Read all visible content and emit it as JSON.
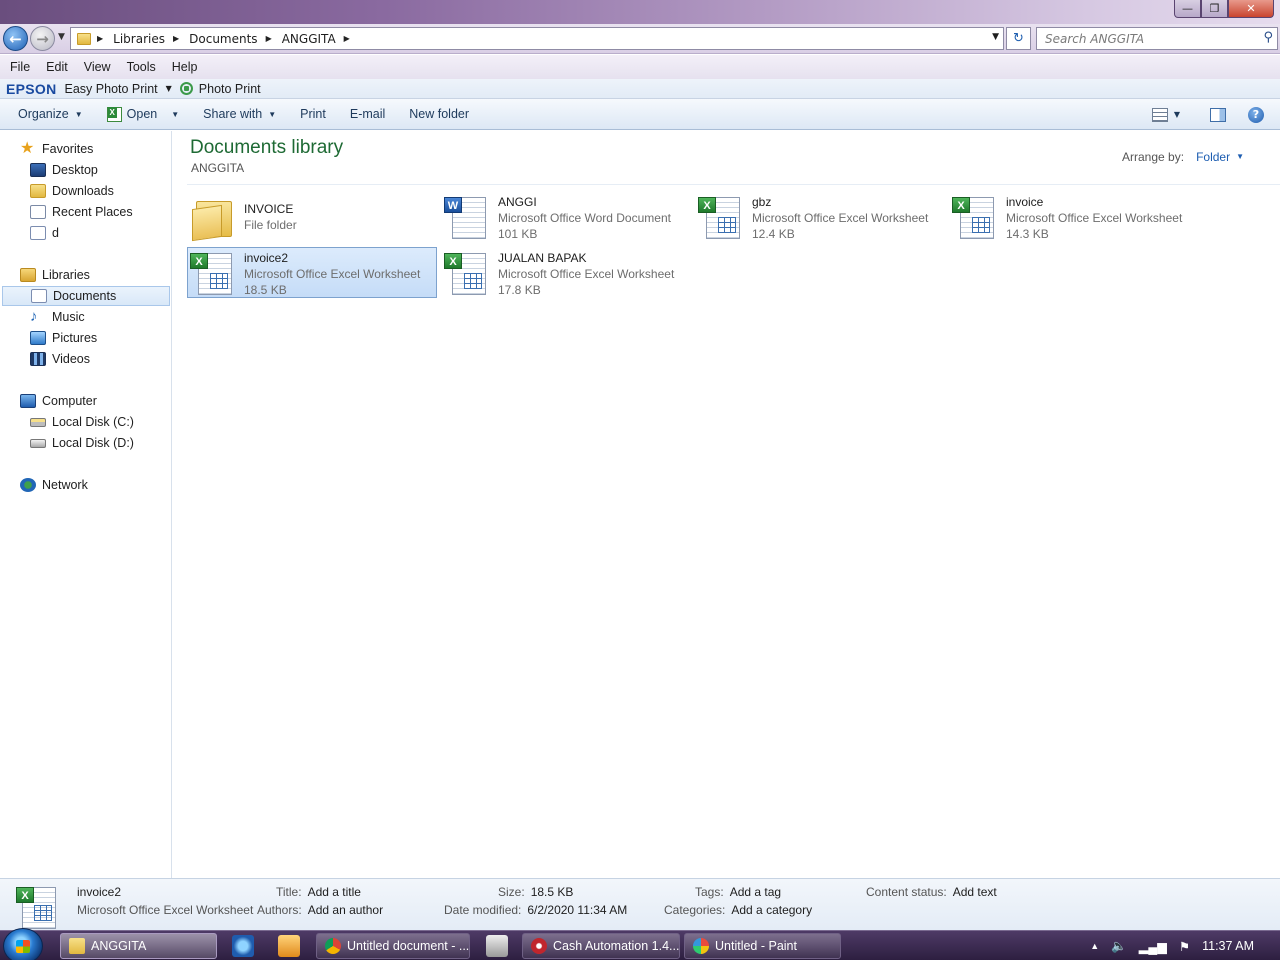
{
  "window": {
    "minimize_glyph": "—",
    "maximize_glyph": "❐",
    "close_glyph": "✕"
  },
  "address": {
    "crumbs": [
      "Libraries",
      "Documents",
      "ANGGITA"
    ],
    "search_placeholder": "Search ANGGITA"
  },
  "menu": [
    "File",
    "Edit",
    "View",
    "Tools",
    "Help"
  ],
  "epson": {
    "logo": "EPSON",
    "easy_photo_print": "Easy Photo Print",
    "photo_print": "Photo Print"
  },
  "commands": {
    "organize": "Organize",
    "open": "Open",
    "share_with": "Share with",
    "print": "Print",
    "email": "E-mail",
    "new_folder": "New folder"
  },
  "nav": {
    "favorites": "Favorites",
    "desktop": "Desktop",
    "downloads": "Downloads",
    "recent_places": "Recent Places",
    "d": "d",
    "libraries": "Libraries",
    "documents": "Documents",
    "music": "Music",
    "pictures": "Pictures",
    "videos": "Videos",
    "computer": "Computer",
    "local_c": "Local Disk (C:)",
    "local_d": "Local Disk (D:)",
    "network": "Network"
  },
  "content": {
    "title": "Documents library",
    "subtitle": "ANGGITA",
    "arrange_label": "Arrange by:",
    "arrange_value": "Folder"
  },
  "files": [
    {
      "name": "INVOICE",
      "type": "File folder",
      "size": "",
      "kind": "folder"
    },
    {
      "name": "ANGGI",
      "type": "Microsoft Office Word Document",
      "size": "101 KB",
      "kind": "word"
    },
    {
      "name": "gbz",
      "type": "Microsoft Office Excel Worksheet",
      "size": "12.4 KB",
      "kind": "excel"
    },
    {
      "name": "invoice",
      "type": "Microsoft Office Excel Worksheet",
      "size": "14.3 KB",
      "kind": "excel"
    },
    {
      "name": "invoice2",
      "type": "Microsoft Office Excel Worksheet",
      "size": "18.5 KB",
      "kind": "excel",
      "selected": true
    },
    {
      "name": "JUALAN BAPAK",
      "type": "Microsoft Office Excel Worksheet",
      "size": "17.8 KB",
      "kind": "excel"
    }
  ],
  "details": {
    "name": "invoice2",
    "type": "Microsoft Office Excel Worksheet",
    "title_label": "Title:",
    "title_value": "Add a title",
    "authors_label": "Authors:",
    "authors_value": "Add an author",
    "size_label": "Size:",
    "size_value": "18.5 KB",
    "modified_label": "Date modified:",
    "modified_value": "6/2/2020 11:34 AM",
    "tags_label": "Tags:",
    "tags_value": "Add a tag",
    "categories_label": "Categories:",
    "categories_value": "Add a category",
    "status_label": "Content status:",
    "status_value": "Add text"
  },
  "taskbar": {
    "explorer": "ANGGITA",
    "chrome": "Untitled document - ...",
    "cash": "Cash Automation 1.4...",
    "paint": "Untitled - Paint",
    "clock": "11:37 AM"
  }
}
